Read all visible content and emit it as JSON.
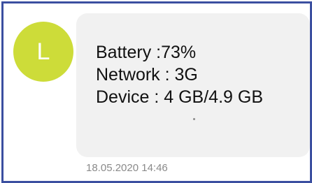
{
  "avatar": {
    "letter": "L",
    "color": "#cddc39"
  },
  "message": {
    "lines": [
      "Battery :73%",
      "Network : 3G",
      "Device : 4 GB/4.9 GB"
    ],
    "timestamp": "18.05.2020 14:46"
  },
  "colors": {
    "frame_border": "#3b4fa0",
    "bubble_background": "#f1f1f1",
    "timestamp_text": "#8a8a8a"
  }
}
